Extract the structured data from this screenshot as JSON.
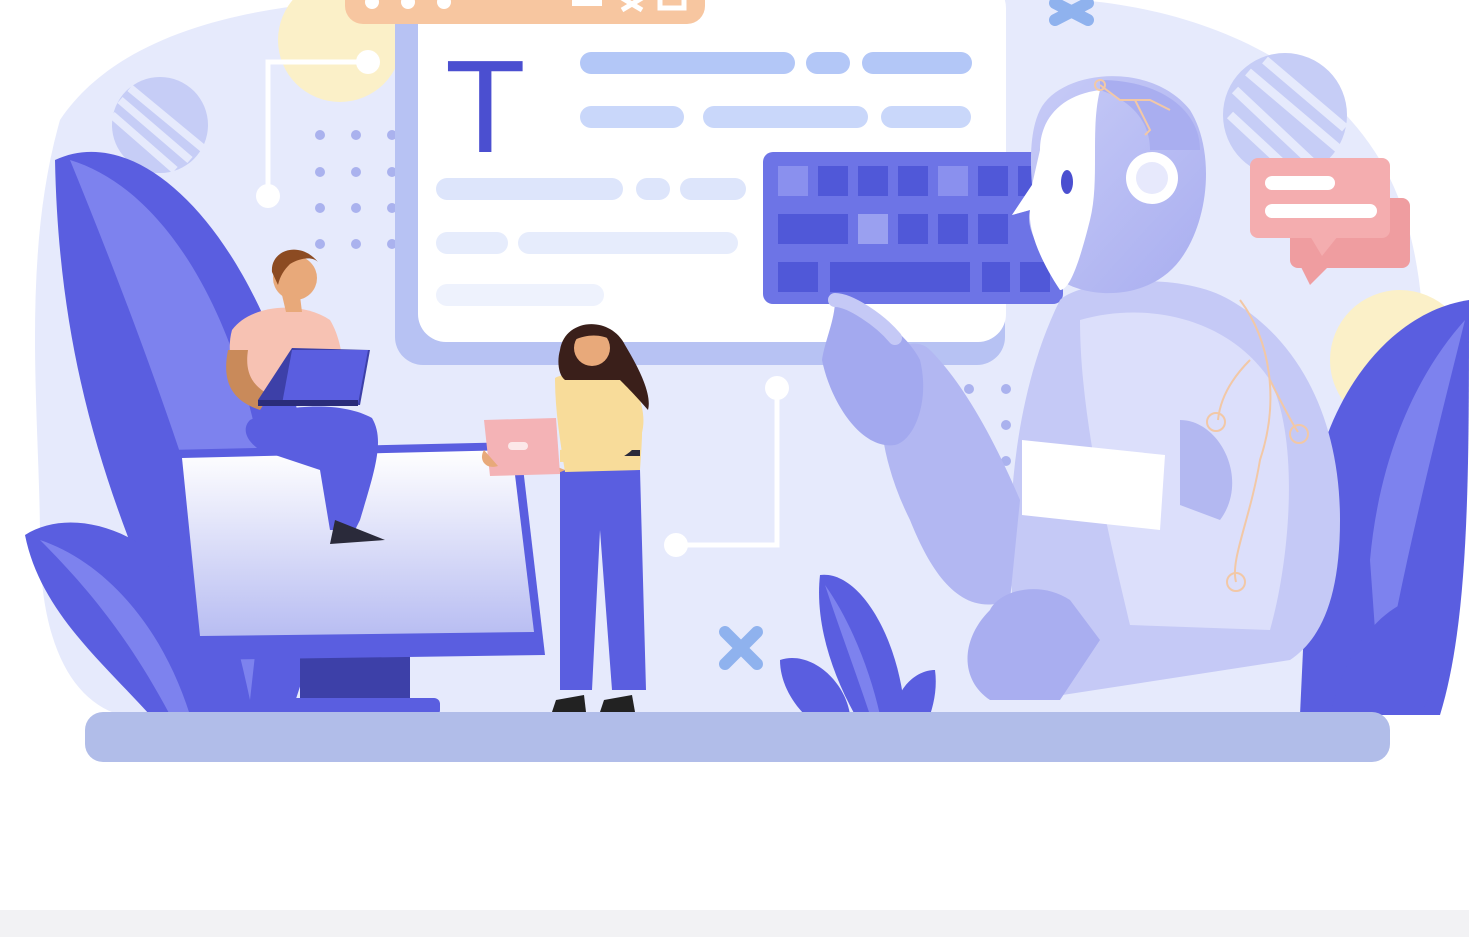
{
  "illustration": {
    "window_glyph": "T",
    "colors": {
      "primary": "#5a5ee0",
      "primary_light": "#8b8ff0",
      "pale": "#e3e7fb",
      "ground": "#b1bde9",
      "accent_peach": "#f7c6a0",
      "accent_pink": "#f3a7a9",
      "accent_yellow": "#fbf0c8"
    },
    "icons": [
      "close-x-icon",
      "close-x-icon",
      "chat-bubble-icon",
      "keyboard-icon",
      "robot-figure",
      "person-man-laptop",
      "person-woman-tablet",
      "monitor-icon"
    ]
  }
}
